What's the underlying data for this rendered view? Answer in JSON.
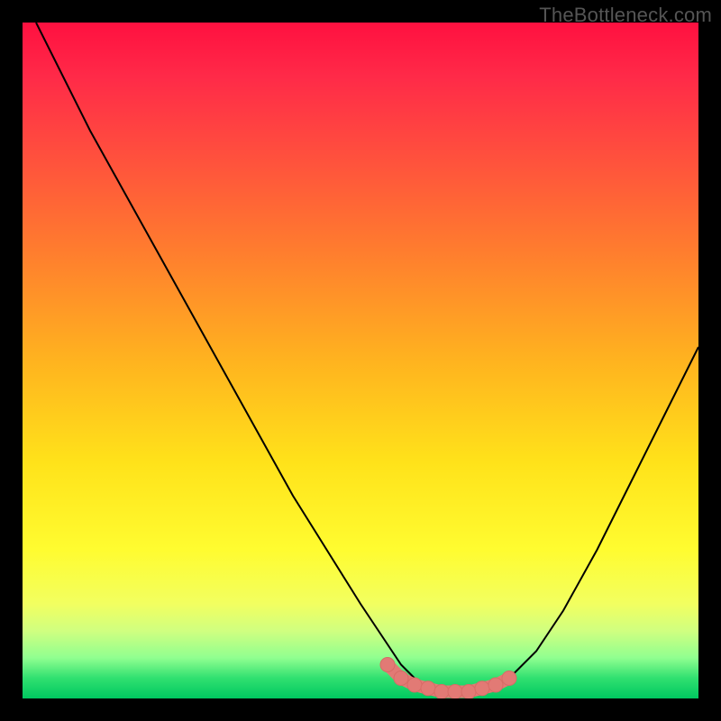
{
  "watermark": "TheBottleneck.com",
  "colors": {
    "curve": "#000000",
    "marker_fill": "#e27a75",
    "marker_stroke": "#d86b66",
    "frame_bg": "#000000"
  },
  "chart_data": {
    "type": "line",
    "title": "",
    "xlabel": "",
    "ylabel": "",
    "xlim": [
      0,
      100
    ],
    "ylim": [
      0,
      100
    ],
    "grid": false,
    "legend": false,
    "series": [
      {
        "name": "bottleneck-curve",
        "x": [
          2,
          6,
          10,
          15,
          20,
          25,
          30,
          35,
          40,
          45,
          50,
          54,
          56,
          58,
          60,
          62,
          64,
          66,
          68,
          70,
          72,
          76,
          80,
          85,
          90,
          95,
          100
        ],
        "values": [
          100,
          92,
          84,
          75,
          66,
          57,
          48,
          39,
          30,
          22,
          14,
          8,
          5,
          3,
          2,
          1.5,
          1,
          1,
          1.5,
          2,
          3,
          7,
          13,
          22,
          32,
          42,
          52
        ]
      }
    ],
    "markers": {
      "name": "optimal-range",
      "x": [
        54,
        56,
        58,
        60,
        62,
        64,
        66,
        68,
        70,
        72
      ],
      "values": [
        5,
        3,
        2,
        1.5,
        1,
        1,
        1,
        1.5,
        2,
        3
      ]
    }
  }
}
